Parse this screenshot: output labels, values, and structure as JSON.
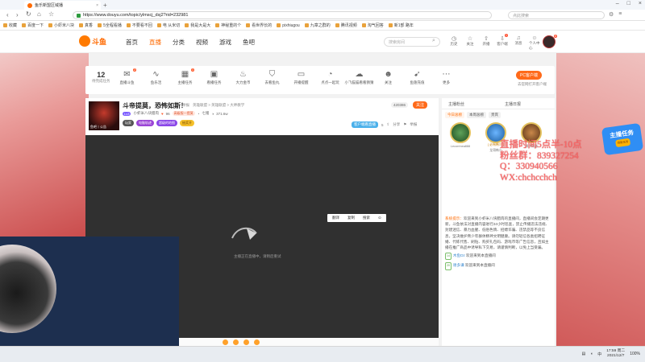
{
  "browser": {
    "tab_title": "鱼乐新盟区域播",
    "url": "https://www.douyu.com/topic/ylmscj_dsj2?rid=232981",
    "search_placeholder": "点此搜索",
    "bookmarks": [
      "收藏",
      "百度一下",
      "小虾米八块",
      "真香",
      "5全程看播",
      "不要看不回",
      "电 从米切",
      "我是大是大",
      "神秘重的个",
      "看世界长的",
      "pixhiugou",
      "九章之群的",
      "腾讯视频",
      "淘气回答",
      "新1部 路年"
    ]
  },
  "site": {
    "logo_text": "斗鱼",
    "nav": [
      "首页",
      "直播",
      "分类",
      "视频",
      "游戏",
      "鱼吧"
    ],
    "active_nav": "直播",
    "search_placeholder": "搜索房间",
    "header_tools": [
      {
        "label": "历史",
        "icon": "clock-icon",
        "badge": ""
      },
      {
        "label": "关注",
        "icon": "star-icon",
        "badge": ""
      },
      {
        "label": "开播",
        "icon": "upload-icon",
        "badge": ""
      },
      {
        "label": "客户端",
        "icon": "download-icon",
        "badge": "1"
      },
      {
        "label": "消息",
        "icon": "bell-icon",
        "badge": ""
      },
      {
        "label": "个人中心",
        "icon": "user-icon",
        "badge": ""
      }
    ],
    "avatar_badge": "6"
  },
  "tasks": {
    "count": "12",
    "count_label": "待完成任务",
    "items": [
      {
        "label": "直播斗鱼",
        "icon": "gift-icon",
        "badge": "2"
      },
      {
        "label": "鱼乐活",
        "icon": "wave-icon",
        "badge": ""
      },
      {
        "label": "主播任务",
        "icon": "calendar-icon",
        "badge": "1"
      },
      {
        "label": "看播任务",
        "icon": "gift-box-icon",
        "badge": ""
      },
      {
        "label": "大力金币",
        "icon": "flame-icon",
        "badge": ""
      },
      {
        "label": "去看鱼丸",
        "icon": "shield-icon",
        "badge": ""
      },
      {
        "label": "开播提醒",
        "icon": "tv-icon",
        "badge": ""
      },
      {
        "label": "点点一起玩",
        "icon": "alarm-icon",
        "badge": ""
      },
      {
        "label": "小飞猫猫看看猜猜",
        "icon": "cloud-icon",
        "badge": ""
      },
      {
        "label": "关注",
        "icon": "people-icon",
        "badge": ""
      },
      {
        "label": "鱼翅充值",
        "icon": "rocket-icon",
        "badge": ""
      },
      {
        "label": "更多",
        "icon": "more-icon",
        "badge": ""
      }
    ],
    "pc_client_label": "PC客户端",
    "pc_client_sub": "去官网打开客户端"
  },
  "room": {
    "title": "斗帝提莫，恐怖如斯！",
    "meta": [
      "举报",
      "英雄联盟 > 英雄联盟 > 大神教学"
    ],
    "avatar_caption": "鱼吧丨公告",
    "level_chip": "Lv3",
    "owner": "小虾米八块腊肉",
    "fans": "96",
    "fan_badge": "高级版一提莫",
    "viewer_icons": [
      "七猪",
      "371.6w"
    ],
    "pills": [
      "玩家",
      "电脑轨迹",
      "超级的地图",
      "抽奖开"
    ],
    "heat": "420386",
    "follow_label": "关注",
    "client_watch": "客户端看直播",
    "share_label": "分享",
    "report_label": "举报",
    "share_count": "5"
  },
  "video": {
    "loading_text": "主播正在直播中，请稍后重试",
    "context_menu": [
      "翻译",
      "复制",
      "搜索"
    ]
  },
  "right_panel": {
    "top_tabs": [
      "主播粉丝",
      "主播日报"
    ],
    "tabs": [
      "今日总榜",
      "本周总榜",
      "贵宾"
    ],
    "ranks": [
      {
        "name": "Lecorrinea888",
        "tag": ""
      },
      {
        "name": "龙哥韩少",
        "tag": "[ 必有韩少 ]"
      },
      {
        "name": "狮子佩瑞",
        "tag": ""
      }
    ],
    "chat": [
      {
        "kind": "sys",
        "prefix": "系统提示：",
        "text": "欢迎来到小虾米八块腊肉的直播间，直播间会定期更新。斗鱼依法对直播内容进行24小时巡查，禁止传播违法违规、封建迷信、暴力血腥、低俗色情、招嫖诈骗、违禁品等不良信息，坚决维护青少年群体精神文明健康。请勿轻信各类招聘征婚、代练代售、刷钻、购买礼包码、游戏币等广告信息，且如主播在推广商品中诱导私下交易，请谨慎判断，以免上当受骗。"
      },
      {
        "kind": "user",
        "level": "14",
        "user": "木鱼Dz",
        "text": "欢迎来到本直播间"
      },
      {
        "kind": "user",
        "level": "20",
        "user": "谢多谦",
        "text": "欢迎来到本直播间"
      }
    ]
  },
  "overlay": {
    "lines": [
      "直播时间5点半-10点",
      "粉丝群：839327254",
      "Q：330940566",
      "WX:chchcchch"
    ],
    "task_badge_title": "主播任务",
    "task_badge_sub": "领取任务"
  },
  "taskbar": {
    "time": "17:59",
    "date": "2021/12/7",
    "weekday": "周二",
    "tray": [
      "中",
      "100%"
    ]
  },
  "colors": {
    "accent": "#ff6a00",
    "overlay_text": "#ff6a6a",
    "video_bg": "#303030"
  }
}
